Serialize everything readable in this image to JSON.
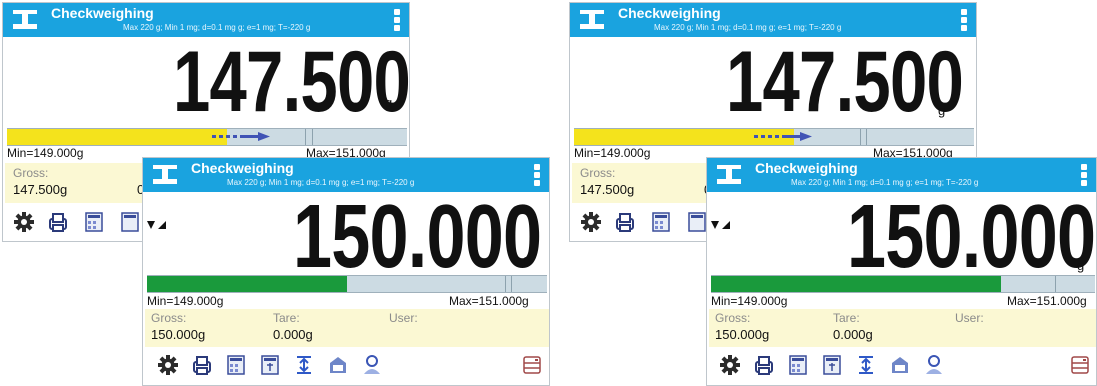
{
  "screens": [
    {
      "back": {
        "title": "Checkweighing",
        "subtitle": "Max 220 g; Min 1 mg; d=0.1 mg g; e=1 mg; T=-220 g",
        "weight": "147.500",
        "unit": "g",
        "bar_fill_fraction": 0.55,
        "bar_color": "#f4e31c",
        "min_label": "Min=149.000g",
        "max_label": "Max=151.000g",
        "gross_label": "Gross:",
        "gross_value": "147.500g",
        "tare_value_partial": "0"
      },
      "front": {
        "title": "Checkweighing",
        "subtitle": "Max 220 g; Min 1 mg; d=0.1 mg g; e=1 mg; T=-220 g",
        "weight": "150.000",
        "unit": "g",
        "bar_fill_fraction": 0.5,
        "bar_color": "#1a9a3c",
        "min_label": "Min=149.000g",
        "max_label": "Max=151.000g",
        "gross_label": "Gross:",
        "gross_value": "150.000g",
        "tare_label": "Tare:",
        "tare_value": "0.000g",
        "user_label": "User:"
      }
    },
    {
      "back": {
        "title": "Checkweighing",
        "subtitle": "Max 220 g; Min 1 mg; d=0.1 mg g; e=1 mg; T=-220 g",
        "weight": "147.500",
        "unit": "g",
        "bar_fill_fraction": 0.55,
        "bar_color": "#f4e31c",
        "min_label": "Min=149.000g",
        "max_label": "Max=151.000g",
        "gross_label": "Gross:",
        "gross_value": "147.500g",
        "tare_value_partial": "0"
      },
      "front": {
        "title": "Checkweighing",
        "subtitle": "Max 220 g; Min 1 mg; d=0.1 mg g; e=1 mg; T=-220 g",
        "weight": "150.000",
        "unit": "g",
        "bar_fill_fraction": 0.755,
        "bar_color": "#1a9a3c",
        "min_label": "Min=149.000g",
        "max_label": "Max=151.000g",
        "gross_label": "Gross:",
        "gross_value": "150.000g",
        "tare_label": "Tare:",
        "tare_value": "0.000g",
        "user_label": "User:"
      }
    }
  ],
  "icons": [
    "gear-icon",
    "print-icon",
    "calculator-icon",
    "scale-unit-icon",
    "align-icon",
    "database-icon",
    "user-icon",
    "server-icon"
  ]
}
